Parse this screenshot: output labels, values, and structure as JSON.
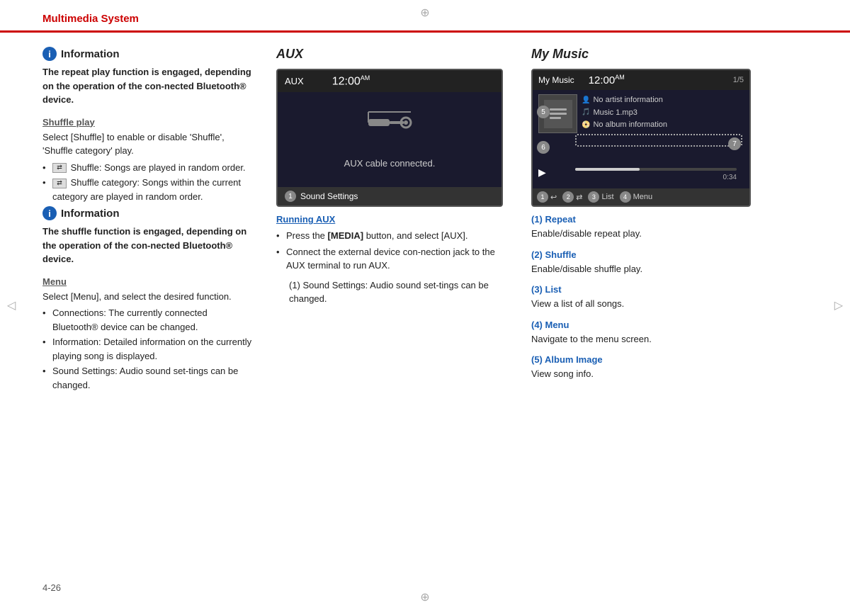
{
  "header": {
    "title": "Multimedia System"
  },
  "decorative": {
    "top_mark": "⊕",
    "bottom_mark": "⊕",
    "left_mark": "◁",
    "right_mark": "▷"
  },
  "left_col": {
    "info1": {
      "icon": "i",
      "title": "Information",
      "body": "The repeat play function is engaged, depending on the operation of the con-nected Bluetooth® device."
    },
    "shuffle_heading": "Shuffle play",
    "shuffle_text": "Select [Shuffle] to enable or disable 'Shuffle', 'Shuffle category' play.",
    "shuffle_bullets": [
      "Shuffle: Songs are played in random order.",
      "Shuffle category: Songs within the current category are played in random order."
    ],
    "info2": {
      "icon": "i",
      "title": "Information",
      "body": "The shuffle function is engaged, depending on the operation of the con-nected Bluetooth® device."
    },
    "menu_heading": "Menu",
    "menu_text": "Select [Menu], and select the desired function.",
    "menu_bullets": [
      "Connections: The currently connected Bluetooth® device can be changed.",
      "Information: Detailed information on the currently playing song is displayed.",
      "Sound Settings: Audio sound set-tings can be changed."
    ],
    "page_num": "4-26"
  },
  "mid_col": {
    "aux_title": "AUX",
    "screen": {
      "label": "AUX",
      "time": "12:00",
      "am_pm": "AM",
      "connected_text": "AUX cable connected.",
      "button_num": "1",
      "button_label": "Sound Settings"
    },
    "running_aux_title": "Running AUX",
    "bullets": [
      {
        "prefix": "Press the ",
        "bold": "[MEDIA]",
        "suffix": " button, and select [AUX]."
      },
      {
        "text": "Connect the external device con-nection jack to the AUX terminal to run AUX."
      }
    ],
    "numbered": [
      "(1) Sound Settings: Audio sound set-tings can be changed."
    ]
  },
  "right_col": {
    "mymusic_title": "My Music",
    "screen": {
      "label": "My Music",
      "time": "12:00",
      "am_pm": "AM",
      "count": "1/5",
      "no_artist": "No artist information",
      "song_name": "Music 1.mp3",
      "no_album": "No album information",
      "time_elapsed": "0:34",
      "num5": "5",
      "num6": "6",
      "num7": "7",
      "bottom": [
        {
          "num": "1",
          "icon": "↩",
          "label": ""
        },
        {
          "num": "2",
          "icon": "⇄",
          "label": ""
        },
        {
          "num": "3",
          "label": "List"
        },
        {
          "num": "4",
          "label": "Menu"
        }
      ]
    },
    "items": [
      {
        "heading": "(1) Repeat",
        "text": "Enable/disable repeat play."
      },
      {
        "heading": "(2) Shuffle",
        "text": "Enable/disable shuffle play."
      },
      {
        "heading": "(3) List",
        "text": "View a list of all songs."
      },
      {
        "heading": "(4) Menu",
        "text": "Navigate to the menu screen."
      },
      {
        "heading": "(5) Album Image",
        "text": "View song info."
      }
    ]
  }
}
